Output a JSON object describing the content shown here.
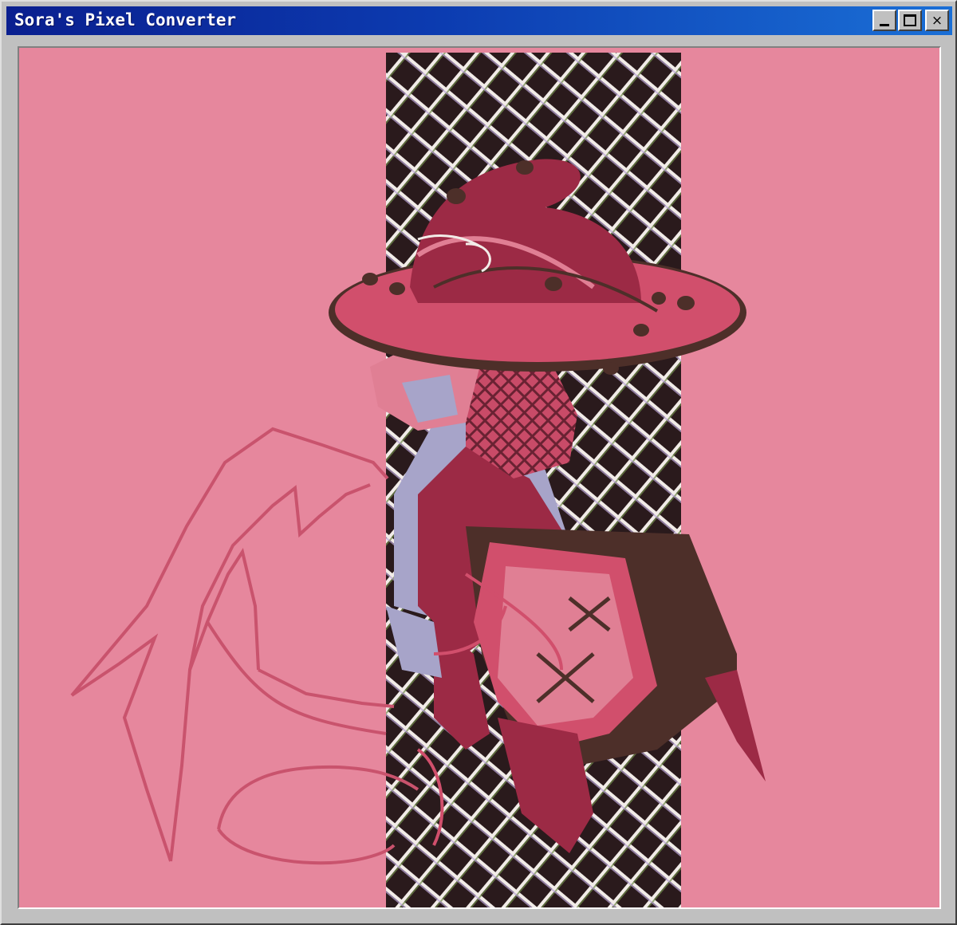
{
  "window": {
    "title": "Sora's Pixel Converter",
    "minimize_icon": "minimize-icon",
    "maximize_icon": "maximize-icon",
    "close_icon": "close-icon",
    "close_glyph": "×"
  },
  "canvas": {
    "content": "pixel-art illustration",
    "colors": {
      "background": "#e6879d",
      "panel_dark": "#2a1a1c",
      "grid_light": "#f2ece8",
      "hat": "#d14f6c",
      "hat_dark": "#9c2a45",
      "wing_line": "#c9536d",
      "skin": "#a7a4c9",
      "coat_brown": "#4d2f29"
    }
  }
}
